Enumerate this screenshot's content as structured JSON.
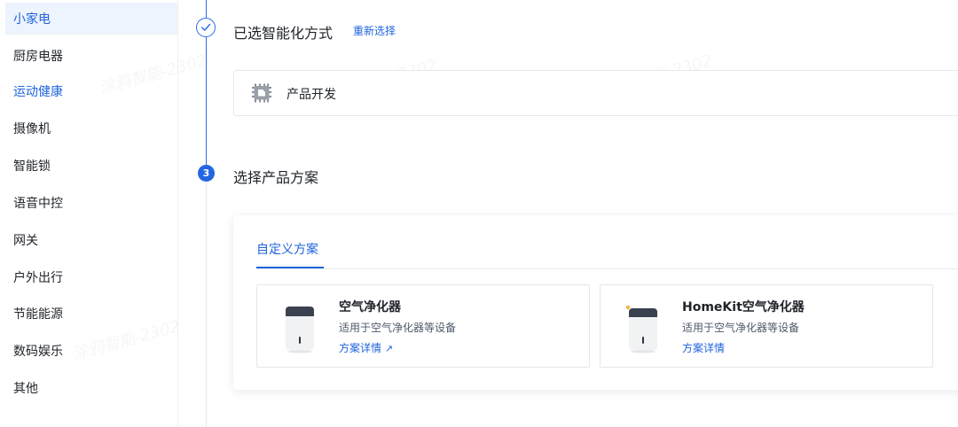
{
  "sidebar": {
    "items": [
      {
        "label": "小家电"
      },
      {
        "label": "厨房电器"
      },
      {
        "label": "运动健康"
      },
      {
        "label": "摄像机"
      },
      {
        "label": "智能锁"
      },
      {
        "label": "语音中控"
      },
      {
        "label": "网关"
      },
      {
        "label": "户外出行"
      },
      {
        "label": "节能能源"
      },
      {
        "label": "数码娱乐"
      },
      {
        "label": "其他"
      }
    ]
  },
  "steps": {
    "selected": {
      "title": "已选智能化方式",
      "reselect": "重新选择",
      "product_label": "产品开发"
    },
    "choose": {
      "number": "3",
      "title": "选择产品方案"
    }
  },
  "solution": {
    "tab_label": "自定义方案",
    "schemes": [
      {
        "name": "空气净化器",
        "desc": "适用于空气净化器等设备",
        "detail": "方案详情",
        "detail_arrow": "↗"
      },
      {
        "name": "HomeKit空气净化器",
        "desc": "适用于空气净化器等设备",
        "detail": "方案详情"
      }
    ]
  },
  "colors": {
    "accent": "#1f63dc",
    "active_bg": "#eef4fd",
    "step_line": "#2a6be6"
  }
}
